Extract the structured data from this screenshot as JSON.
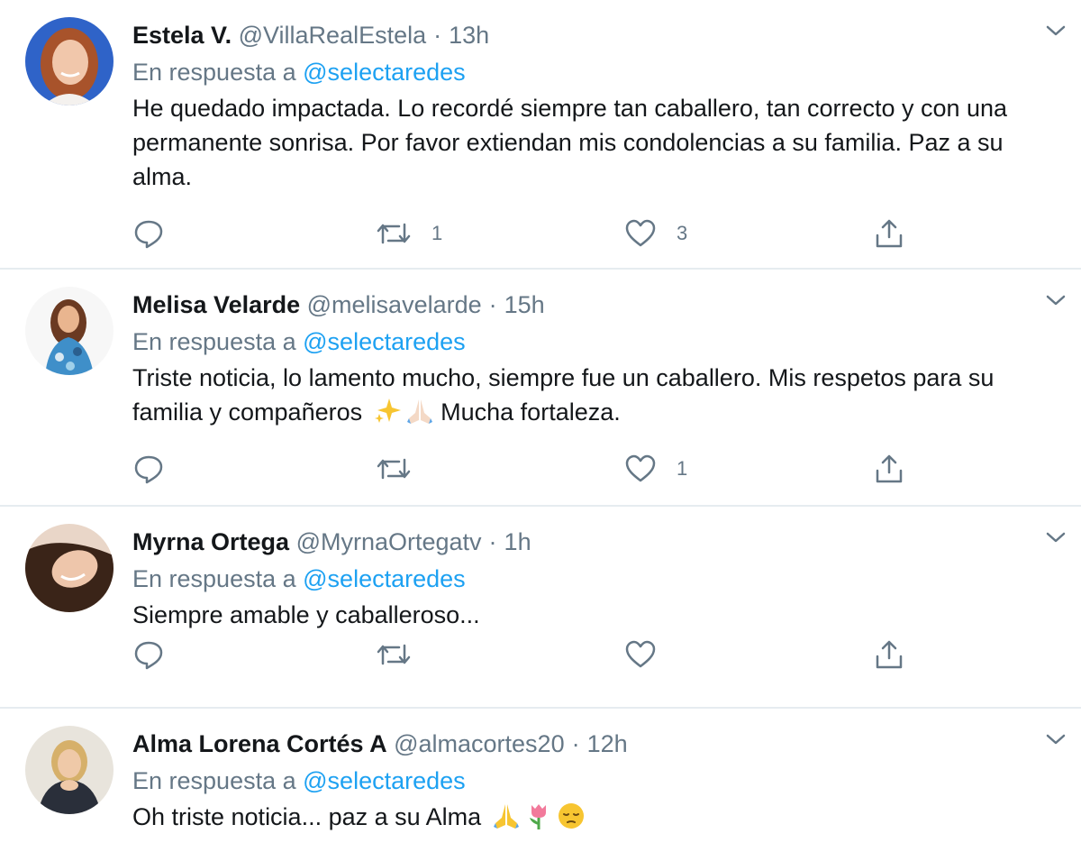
{
  "tweets": [
    {
      "name": "Estela V.",
      "handle": "@VillaRealEstela",
      "separator": "·",
      "time": "13h",
      "reply_prefix": "En respuesta a",
      "reply_to": "@selectaredes",
      "text": "He quedado impactada. Lo recordé siempre tan caballero, tan correcto y con una permanente sonrisa. Por favor extiendan mis condolencias a su familia. Paz a su alma.",
      "text_suffix": "",
      "emojis": [],
      "retweets": "1",
      "likes": "3"
    },
    {
      "name": "Melisa Velarde",
      "handle": "@melisavelarde",
      "separator": "·",
      "time": "15h",
      "reply_prefix": "En respuesta a",
      "reply_to": "@selectaredes",
      "text": "Triste noticia, lo lamento mucho, siempre fue un caballero. Mis respetos para su familia y compañeros",
      "text_suffix": "Mucha fortaleza.",
      "emojis": [
        "sparkles-emoji",
        "praying-hands-emoji"
      ],
      "retweets": "",
      "likes": "1"
    },
    {
      "name": "Myrna Ortega",
      "handle": "@MyrnaOrtegatv",
      "separator": "·",
      "time": "1h",
      "reply_prefix": "En respuesta a",
      "reply_to": "@selectaredes",
      "text": "Siempre amable y caballeroso...",
      "text_suffix": "",
      "emojis": [],
      "retweets": "",
      "likes": ""
    },
    {
      "name": "Alma Lorena Cortés A",
      "handle": "@almacortes20",
      "separator": "·",
      "time": "12h",
      "reply_prefix": "En respuesta a",
      "reply_to": "@selectaredes",
      "text": "Oh triste noticia... paz a su Alma",
      "text_suffix": "",
      "emojis": [
        "praying-hands-emoji",
        "tulip-emoji",
        "pensive-face-emoji"
      ],
      "retweets": "",
      "likes": ""
    }
  ],
  "colors": {
    "text": "#14171a",
    "secondary": "#657786",
    "link": "#1da1f2",
    "divider": "#e6ecf0"
  },
  "icons": [
    "reply-icon",
    "retweet-icon",
    "like-icon",
    "share-icon",
    "chevron-down-icon"
  ]
}
